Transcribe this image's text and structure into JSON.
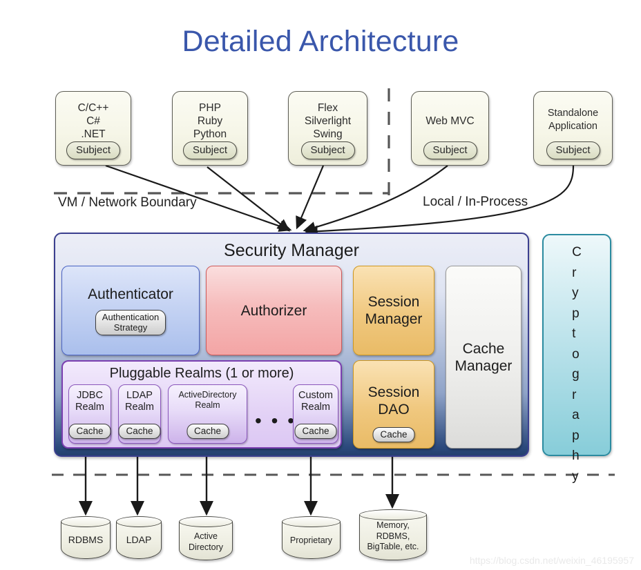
{
  "title": "Detailed Architecture",
  "watermark": "https://blog.csdn.net/weixin_46195957",
  "boundaries": {
    "network": "VM / Network Boundary",
    "local": "Local / In-Process"
  },
  "clients": [
    {
      "name": "C/C++\nC#\n.NET",
      "subject": "Subject"
    },
    {
      "name": "PHP\nRuby\nPython",
      "subject": "Subject"
    },
    {
      "name": "Flex\nSilverlight\nSwing",
      "subject": "Subject"
    },
    {
      "name": "Web MVC",
      "subject": "Subject"
    },
    {
      "name": "Standalone\nApplication",
      "subject": "Subject"
    }
  ],
  "security_manager": {
    "title": "Security Manager",
    "authenticator": {
      "label": "Authenticator",
      "strategy": "Authentication\nStrategy"
    },
    "authorizer": {
      "label": "Authorizer"
    },
    "session_manager": {
      "label": "Session\nManager"
    },
    "session_dao": {
      "label": "Session\nDAO",
      "cache": "Cache"
    },
    "cache_manager": {
      "label": "Cache\nManager"
    },
    "realms": {
      "title": "Pluggable Realms (1 or more)",
      "ellipsis": "• • •",
      "items": [
        {
          "label": "JDBC\nRealm",
          "cache": "Cache"
        },
        {
          "label": "LDAP\nRealm",
          "cache": "Cache"
        },
        {
          "label": "ActiveDirectory\nRealm",
          "cache": "Cache"
        },
        {
          "label": "Custom\nRealm",
          "cache": "Cache"
        }
      ]
    }
  },
  "cryptography": {
    "label": "Cryptography"
  },
  "datastores": [
    {
      "label": "RDBMS"
    },
    {
      "label": "LDAP"
    },
    {
      "label": "Active\nDirectory"
    },
    {
      "label": "Proprietary"
    },
    {
      "label": "Memory,\nRDBMS,\nBigTable, etc."
    }
  ],
  "colors": {
    "title_blue": "#3a57ab",
    "secmgr_border": "#3b3f8f",
    "secmgr_bottom": "#24406e",
    "authenticator": "#c5d3f3",
    "authorizer": "#f6bcbc",
    "session": "#f0c87f",
    "cache": "#eeeeec",
    "realms": "#e3d2f6",
    "crypto": "#bfe4ec",
    "subject": "#d9dcc2"
  }
}
